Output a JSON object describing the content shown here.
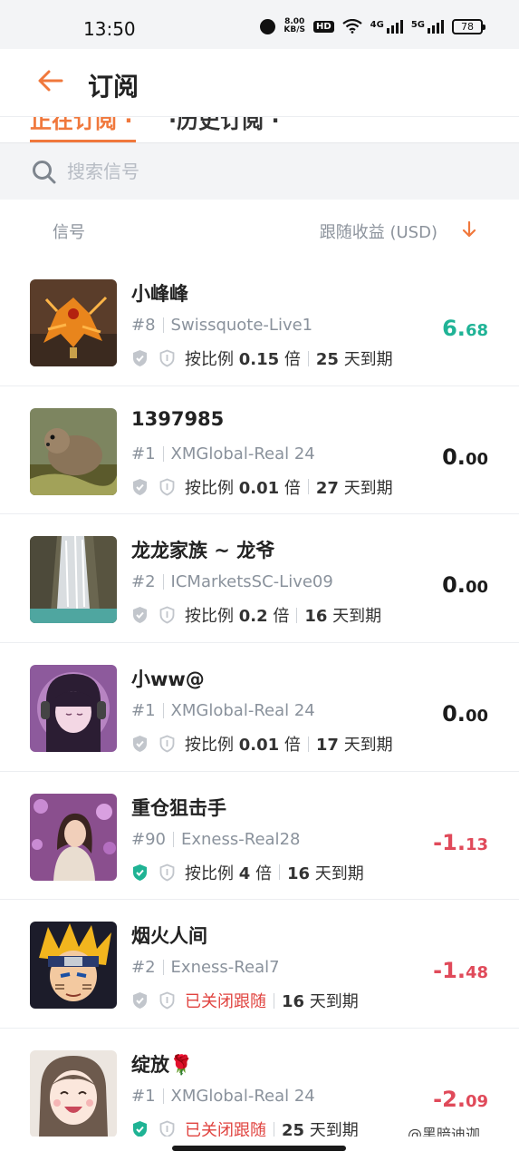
{
  "status_bar": {
    "time": "13:50",
    "net_speed_value": "8.00",
    "net_speed_unit": "KB/S",
    "hd_label": "HD",
    "sim1_label": "4G",
    "sim2_label": "5G",
    "battery": "78"
  },
  "header": {
    "title": "订阅",
    "back_icon": "arrow-left-icon"
  },
  "tabs": [
    {
      "label": "正在订阅 ·",
      "active": true
    },
    {
      "label": "·历史订阅 ·",
      "active": false
    }
  ],
  "search": {
    "placeholder": "搜索信号",
    "value": ""
  },
  "list_header": {
    "col_signal": "信号",
    "col_profit": "跟随收益 (USD)",
    "sort_icon": "arrow-down-icon"
  },
  "colors": {
    "accent": "#f0783c",
    "positive": "#20b396",
    "negative": "#e04a5a",
    "closed": "#e0433f",
    "verified_shield": "#1fb394",
    "muted_shield": "#c2c6cc"
  },
  "signals": [
    {
      "name": "小峰峰",
      "rank": "#8",
      "broker": "Swissquote-Live1",
      "ratio_prefix": "按比例",
      "ratio": "0.15",
      "ratio_suffix": "倍",
      "expire_days": "25",
      "expire_suffix": "天到期",
      "closed": false,
      "closed_label": "",
      "verified": false,
      "profit_int": "6.",
      "profit_dec": "68",
      "profit_sign": "pos",
      "avatar": "orange-dragon-figure"
    },
    {
      "name": "1397985",
      "rank": "#1",
      "broker": "XMGlobal-Real 24",
      "ratio_prefix": "按比例",
      "ratio": "0.01",
      "ratio_suffix": "倍",
      "expire_days": "27",
      "expire_suffix": "天到期",
      "closed": false,
      "closed_label": "",
      "verified": false,
      "profit_int": "0.",
      "profit_dec": "00",
      "profit_sign": "zero",
      "avatar": "otter-photo"
    },
    {
      "name": "龙龙家族 ~ 龙爷",
      "rank": "#2",
      "broker": "ICMarketsSC-Live09",
      "ratio_prefix": "按比例",
      "ratio": "0.2",
      "ratio_suffix": "倍",
      "expire_days": "16",
      "expire_suffix": "天到期",
      "closed": false,
      "closed_label": "",
      "verified": false,
      "profit_int": "0.",
      "profit_dec": "00",
      "profit_sign": "zero",
      "avatar": "waterfall-photo"
    },
    {
      "name": "小ww@",
      "rank": "#1",
      "broker": "XMGlobal-Real 24",
      "ratio_prefix": "按比例",
      "ratio": "0.01",
      "ratio_suffix": "倍",
      "expire_days": "17",
      "expire_suffix": "天到期",
      "closed": false,
      "closed_label": "",
      "verified": false,
      "profit_int": "0.",
      "profit_dec": "00",
      "profit_sign": "zero",
      "avatar": "anime-girl-headphones"
    },
    {
      "name": "重仓狙击手",
      "rank": "#90",
      "broker": "Exness-Real28",
      "ratio_prefix": "按比例",
      "ratio": "4",
      "ratio_suffix": "倍",
      "expire_days": "16",
      "expire_suffix": "天到期",
      "closed": false,
      "closed_label": "",
      "verified": true,
      "profit_int": "-1.",
      "profit_dec": "13",
      "profit_sign": "neg",
      "avatar": "girl-flowers-photo"
    },
    {
      "name": "烟火人间",
      "rank": "#2",
      "broker": "Exness-Real7",
      "ratio_prefix": "",
      "ratio": "",
      "ratio_suffix": "",
      "expire_days": "16",
      "expire_suffix": "天到期",
      "closed": true,
      "closed_label": "已关闭跟随",
      "verified": false,
      "profit_int": "-1.",
      "profit_dec": "48",
      "profit_sign": "neg",
      "avatar": "anime-ninja"
    },
    {
      "name": "绽放🌹",
      "rank": "#1",
      "broker": "XMGlobal-Real 24",
      "ratio_prefix": "",
      "ratio": "",
      "ratio_suffix": "",
      "expire_days": "25",
      "expire_suffix": "天到期",
      "closed": true,
      "closed_label": "已关闭跟随",
      "verified": true,
      "profit_int": "-2.",
      "profit_dec": "09",
      "profit_sign": "neg",
      "avatar": "anime-girl-smiling"
    }
  ],
  "watermark": "@黑暗迪迦"
}
